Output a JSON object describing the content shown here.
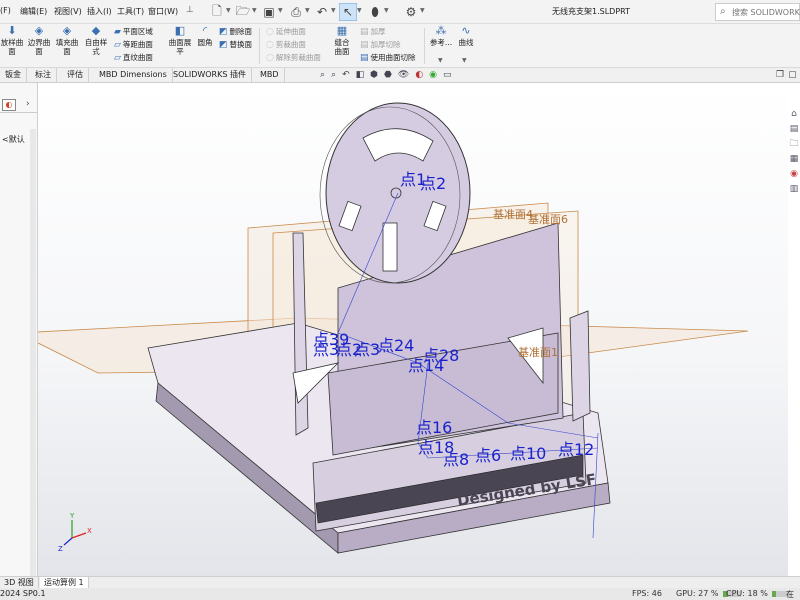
{
  "menu": {
    "items": [
      "(F)",
      "编辑(E)",
      "视图(V)",
      "插入(I)",
      "工具(T)",
      "窗口(W)"
    ]
  },
  "window": {
    "title": "无线充支架1.SLDPRT"
  },
  "search": {
    "placeholder": "搜索 SOLIDWORKS"
  },
  "ribbon": {
    "big": [
      {
        "label": "放样曲\n面",
        "icon": "loft-surface-icon"
      },
      {
        "label": "边界曲\n面",
        "icon": "boundary-surface-icon"
      },
      {
        "label": "填充曲\n面",
        "icon": "filled-surface-icon"
      },
      {
        "label": "自由样\n式",
        "icon": "freeform-icon"
      },
      {
        "label": "曲面展\n平",
        "icon": "surface-flatten-icon"
      },
      {
        "label": "圆角",
        "icon": "fillet-icon"
      },
      {
        "label": "缝合\n曲面",
        "icon": "knit-surface-icon"
      },
      {
        "label": "参考...",
        "icon": "reference-geometry-icon"
      },
      {
        "label": "曲线",
        "icon": "curves-icon"
      }
    ],
    "small": {
      "planar": "平面区域",
      "offset": "等距曲面",
      "ruled": "直纹曲面",
      "delete_face": "删除面",
      "replace_face": "替换面",
      "extend": "延伸曲面",
      "trim": "剪裁曲面",
      "untrim": "解除剪裁曲面",
      "thicken": "加厚",
      "thicken_cut": "加厚切除",
      "surface_cut": "使用曲面切除"
    }
  },
  "tabs": [
    "钣金",
    "标注",
    "评估",
    "MBD Dimensions",
    "SOLIDWORKS 插件",
    "MBD"
  ],
  "left_panel": {
    "default_label": "<默认"
  },
  "viewport": {
    "planes": [
      "基准面4",
      "基准面6",
      "基准面1"
    ],
    "points": {
      "p1": "点1",
      "p2": "点2",
      "p39": "点39",
      "p3": "点3",
      "p2x": "点2",
      "p3x": "点3",
      "p24": "点24",
      "p28": "点28",
      "p14": "点14",
      "p16": "点16",
      "p18": "点18",
      "p8": "点8",
      "p6": "点6",
      "p10": "点10",
      "p12": "点12"
    },
    "engraving": "Designed by LSF",
    "triad": {
      "x": "X",
      "y": "Y",
      "z": "Z"
    }
  },
  "bottom_tabs": [
    "3D 视图",
    "运动算例 1"
  ],
  "status": {
    "version": "2024 SP0.1",
    "fps_label": "FPS: 46",
    "gpu_label": "GPU: 27 %",
    "cpu_label": "CPU: 18 %",
    "gpu_level": 0.27,
    "cpu_level": 0.18,
    "right": "在"
  }
}
